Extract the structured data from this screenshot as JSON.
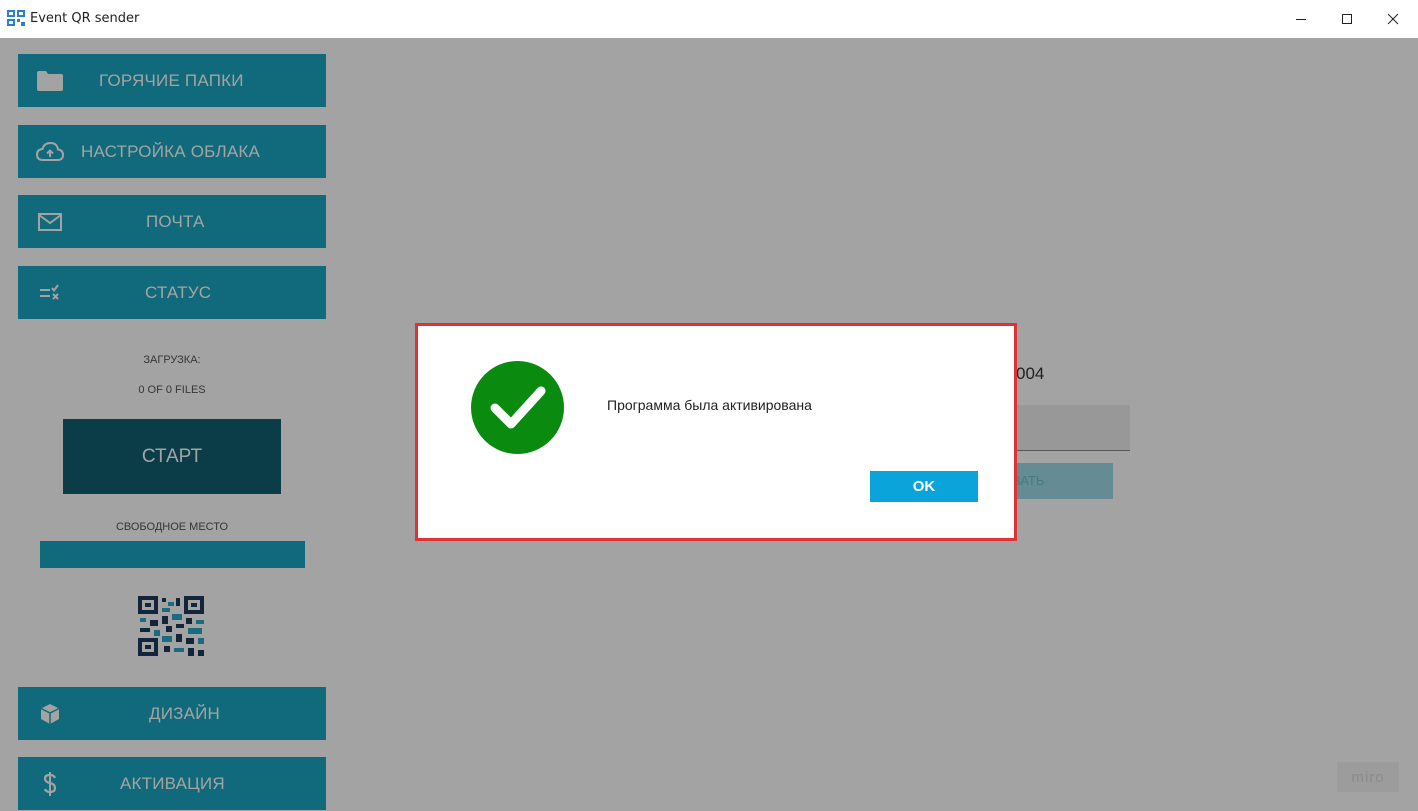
{
  "window": {
    "title": "Event QR sender",
    "controls": {
      "minimize": "minimize",
      "maximize": "maximize",
      "close": "close"
    }
  },
  "sidebar": {
    "items": [
      {
        "label": "ГОРЯЧИЕ ПАПКИ",
        "icon": "folder-icon"
      },
      {
        "label": "НАСТРОЙКА ОБЛАКА",
        "icon": "cloud-upload-icon"
      },
      {
        "label": "ПОЧТА",
        "icon": "mail-icon"
      },
      {
        "label": "СТАТУС",
        "icon": "status-list-icon"
      }
    ],
    "upload_label": "ЗАГРУЗКА:",
    "upload_count": "0 OF 0 FILES",
    "start_label": "СТАРТ",
    "free_space_label": "СВОБОДНОЕ МЕСТО",
    "bottom_items": [
      {
        "label": "ДИЗАЙН",
        "icon": "design-cube-icon"
      },
      {
        "label": "АКТИВАЦИЯ",
        "icon": "dollar-icon"
      }
    ]
  },
  "background": {
    "partial_text": "004",
    "partial_button": "ВАТЬ",
    "watermark": "miro"
  },
  "dialog": {
    "message": "Программа была активирована",
    "ok_label": "OK",
    "icon": "success-check-icon"
  },
  "colors": {
    "accent": "#1aa6c0",
    "start_button": "#11606f",
    "ok_button": "#0aa4da",
    "success": "#0a8b0f",
    "highlight_border": "#e03232"
  }
}
